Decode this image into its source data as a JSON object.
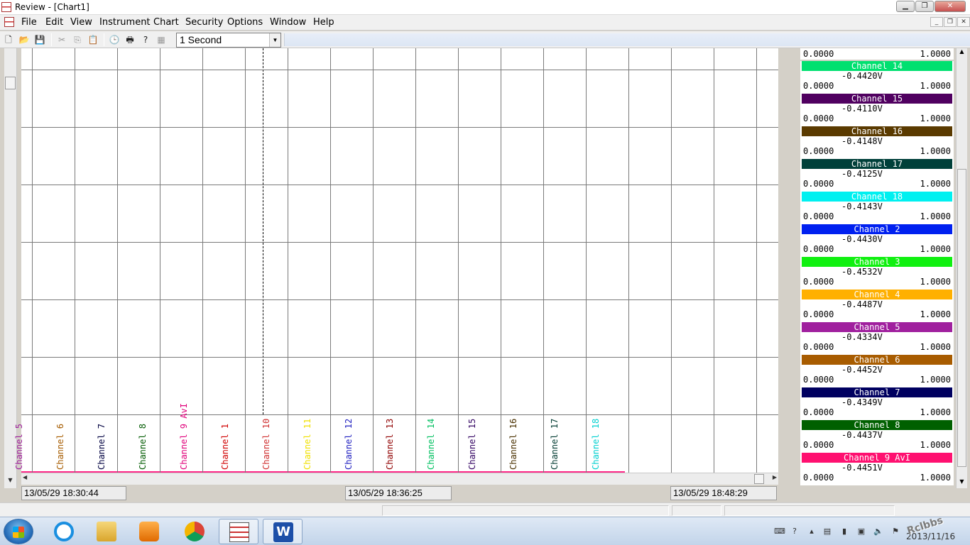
{
  "window": {
    "title": "Review - [Chart1]"
  },
  "menu": [
    "File",
    "Edit",
    "View",
    "Instrument",
    "Chart",
    "Security",
    "Options",
    "Window",
    "Help"
  ],
  "toolbar": {
    "icons": [
      "new-file-icon",
      "open-folder-icon",
      "save-icon",
      "cut-icon",
      "copy-icon",
      "paste-icon",
      "clock-icon",
      "print-icon",
      "help-icon",
      "chart-settings-icon"
    ],
    "rate_select": {
      "value": "1 Second"
    }
  },
  "chart": {
    "trace_color": "#ff2a8a",
    "channel_labels": [
      {
        "text": "Channel 5",
        "color": "#a0209e"
      },
      {
        "text": "Channel 6",
        "color": "#a65c00"
      },
      {
        "text": "Channel 7",
        "color": "#000040"
      },
      {
        "text": "Channel 8",
        "color": "#005a00"
      },
      {
        "text": "Channel 9 AvI",
        "color": "#e0007a"
      },
      {
        "text": "Channel 1",
        "color": "#d00000"
      },
      {
        "text": "Channel 10",
        "color": "#d03030"
      },
      {
        "text": "Channel 11",
        "color": "#f0e000"
      },
      {
        "text": "Channel 12",
        "color": "#2020c0"
      },
      {
        "text": "Channel 13",
        "color": "#900000"
      },
      {
        "text": "Channel 14",
        "color": "#00c060"
      },
      {
        "text": "Channel 15",
        "color": "#300060"
      },
      {
        "text": "Channel 16",
        "color": "#4a3000"
      },
      {
        "text": "Channel 17",
        "color": "#003a30"
      },
      {
        "text": "Channel 18",
        "color": "#00d0d0"
      }
    ],
    "times": [
      "13/05/29 18:30:44",
      "13/05/29 18:36:25",
      "13/05/29 18:48:29"
    ]
  },
  "panel": {
    "top_row": {
      "min": "0.0000",
      "max": "1.0000"
    },
    "channels": [
      {
        "name": "Channel 14",
        "color": "#00e070",
        "text_color": "#ffffff",
        "value": "-0.4420V",
        "min": "0.0000",
        "max": "1.0000"
      },
      {
        "name": "Channel 15",
        "color": "#500060",
        "text_color": "#ffffff",
        "value": "-0.4110V",
        "min": "0.0000",
        "max": "1.0000"
      },
      {
        "name": "Channel 16",
        "color": "#5a3a00",
        "text_color": "#ffffff",
        "value": "-0.4148V",
        "min": "0.0000",
        "max": "1.0000"
      },
      {
        "name": "Channel 17",
        "color": "#00403a",
        "text_color": "#ffffff",
        "value": "-0.4125V",
        "min": "0.0000",
        "max": "1.0000"
      },
      {
        "name": "Channel 18",
        "color": "#00f0f0",
        "text_color": "#ffffff",
        "value": "-0.4143V",
        "min": "0.0000",
        "max": "1.0000"
      },
      {
        "name": "Channel 2",
        "color": "#0020f0",
        "text_color": "#ffffff",
        "value": "-0.4430V",
        "min": "0.0000",
        "max": "1.0000"
      },
      {
        "name": "Channel 3",
        "color": "#10f010",
        "text_color": "#ffffff",
        "value": "-0.4532V",
        "min": "0.0000",
        "max": "1.0000"
      },
      {
        "name": "Channel 4",
        "color": "#ffb000",
        "text_color": "#ffffff",
        "value": "-0.4487V",
        "min": "0.0000",
        "max": "1.0000"
      },
      {
        "name": "Channel 5",
        "color": "#a0209e",
        "text_color": "#ffffff",
        "value": "-0.4334V",
        "min": "0.0000",
        "max": "1.0000"
      },
      {
        "name": "Channel 6",
        "color": "#a85c00",
        "text_color": "#ffffff",
        "value": "-0.4452V",
        "min": "0.0000",
        "max": "1.0000"
      },
      {
        "name": "Channel 7",
        "color": "#000060",
        "text_color": "#ffffff",
        "value": "-0.4349V",
        "min": "0.0000",
        "max": "1.0000"
      },
      {
        "name": "Channel 8",
        "color": "#006000",
        "text_color": "#ffffff",
        "value": "-0.4437V",
        "min": "0.0000",
        "max": "1.0000"
      },
      {
        "name": "Channel 9 AvI",
        "color": "#ff1070",
        "text_color": "#ffffff",
        "value": "-0.4451V",
        "min": "0.0000",
        "max": "1.0000"
      }
    ]
  },
  "taskbar": {
    "apps": [
      "windows-explorer-icon",
      "internet-explorer-icon",
      "file-manager-icon",
      "media-player-icon",
      "chrome-icon",
      "review-app-icon",
      "word-icon"
    ],
    "tray": [
      "keyboard-icon",
      "help-icon",
      "network-icon",
      "battery-icon",
      "display-icon",
      "volume-icon",
      "flag-icon"
    ],
    "date": "2013/11/16",
    "watermark": "Rclbbs"
  }
}
